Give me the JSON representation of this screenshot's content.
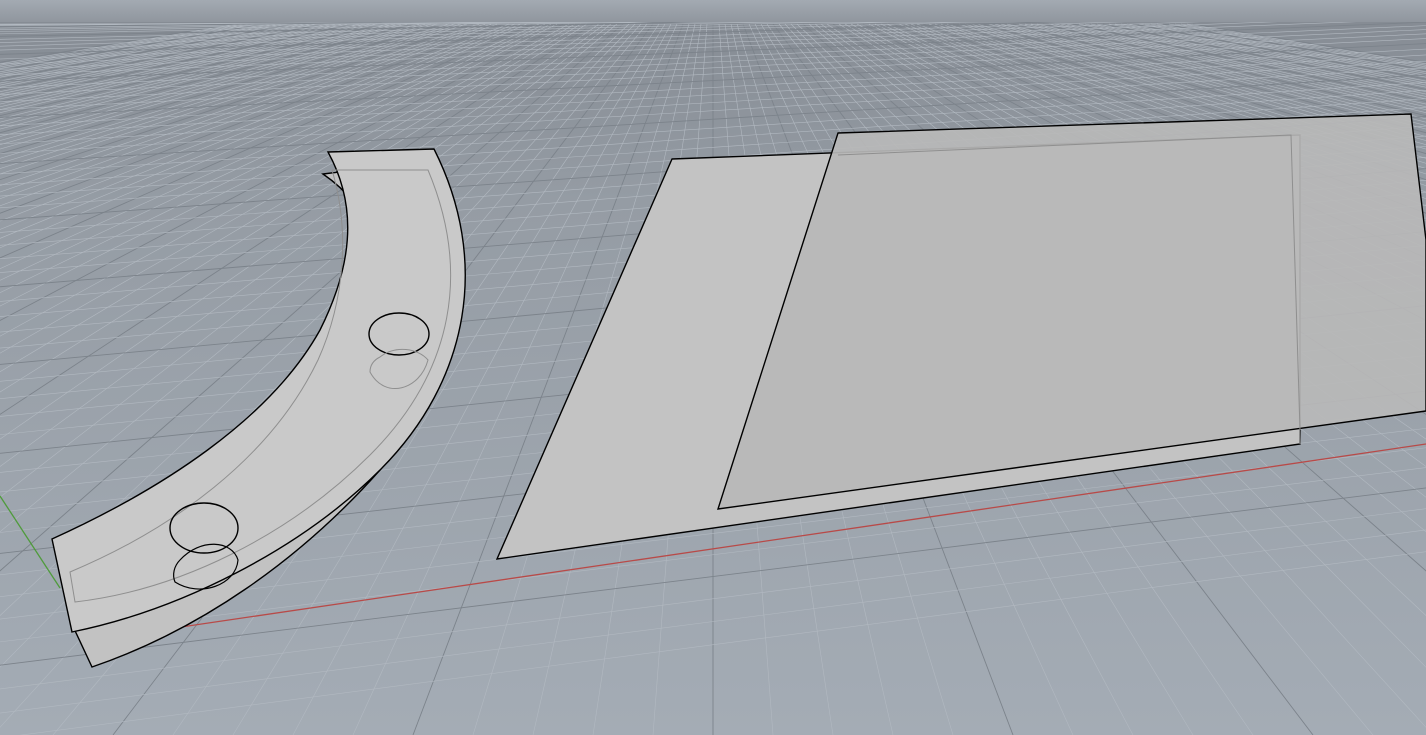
{
  "viewport": {
    "projection": "perspective",
    "display_mode": "shaded",
    "grid": true,
    "colors": {
      "sky": "#9aa1a9",
      "horizon": "#868c94",
      "floor_far": "#8e959d",
      "floor_near": "#a2aab3",
      "grid_minor": "#b2b9c1",
      "grid_major": "#7c838b",
      "x_axis": "#b84a48",
      "y_axis": "#4f9b3c",
      "surface_fill": "#c6c6c6",
      "surface_edge": "#000000",
      "hidden_edge": "#8f8f8f"
    }
  },
  "objects": [
    {
      "name": "curved-strip-with-holes",
      "holes": 2
    },
    {
      "name": "rear-planar-surface"
    },
    {
      "name": "front-planar-surface"
    }
  ]
}
